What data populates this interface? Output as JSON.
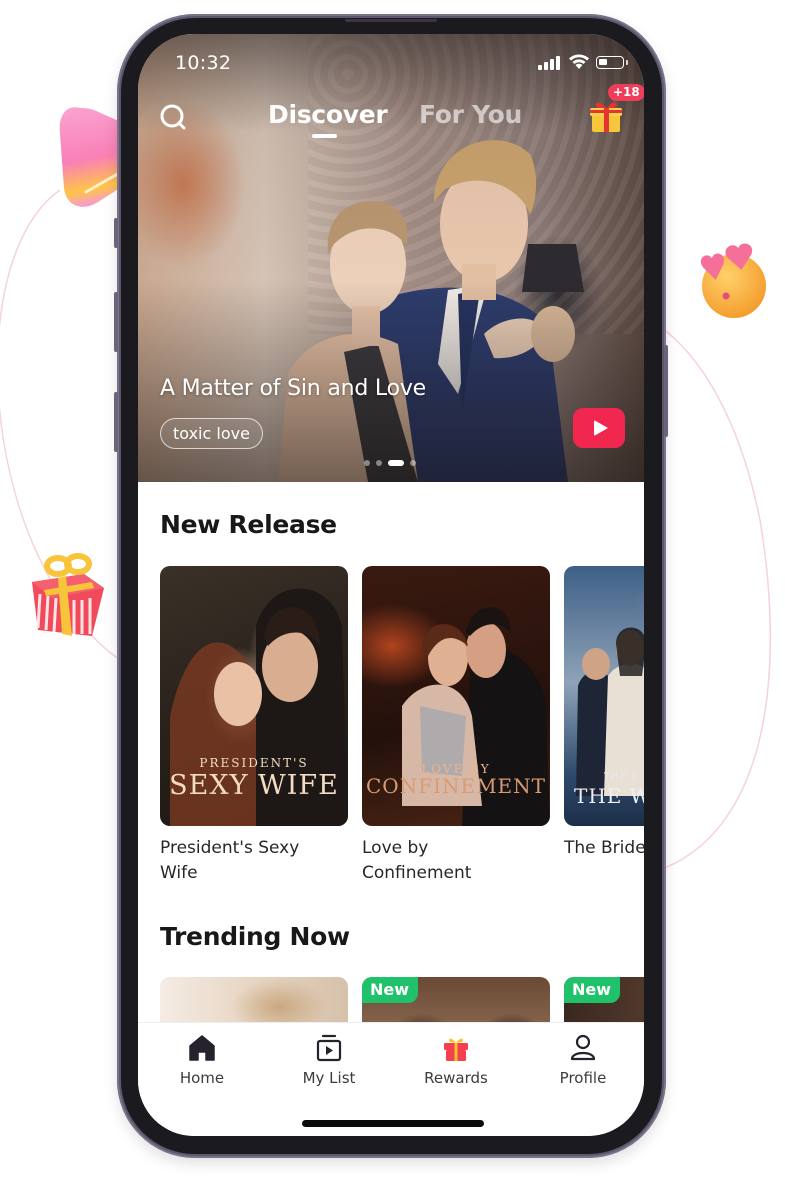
{
  "status_bar": {
    "time": "10:32",
    "battery_level": 0.35
  },
  "top_nav": {
    "search_icon": "search-icon",
    "tabs": [
      {
        "label": "Discover",
        "active": true
      },
      {
        "label": "For You",
        "active": false
      }
    ],
    "gift_icon": "gift-icon",
    "gift_badge": "+18"
  },
  "hero": {
    "title": "A Matter of Sin and Love",
    "tag": "toxic love",
    "play_icon": "play-icon",
    "carousel": {
      "count": 4,
      "active_index": 2
    }
  },
  "new_release": {
    "title": "New Release",
    "items": [
      {
        "title": "President's Sexy Wife",
        "cover_text_small": "PRESIDENT'S",
        "cover_text_large": "SEXY WIFE"
      },
      {
        "title": "Love by Confinement",
        "cover_text_small": "LOVE BY",
        "cover_text_large": "CONFINEMENT"
      },
      {
        "title": "The Bride Wolf King",
        "cover_text_small": "THE B",
        "cover_text_large": "THE WO"
      }
    ]
  },
  "trending": {
    "title": "Trending Now",
    "items": [
      {
        "badge": null
      },
      {
        "badge": "New"
      },
      {
        "badge": "New"
      }
    ]
  },
  "bottom_nav": {
    "items": [
      {
        "label": "Home",
        "icon": "home-icon",
        "active": true
      },
      {
        "label": "My List",
        "icon": "playlist-icon",
        "active": false
      },
      {
        "label": "Rewards",
        "icon": "gift-icon",
        "active": false
      },
      {
        "label": "Profile",
        "icon": "profile-icon",
        "active": false
      }
    ]
  },
  "colors": {
    "accent": "#f2274f",
    "badge_red": "#f03e5a",
    "new_badge_green": "#1fc26b",
    "phone_frame": "#5e566c",
    "text_dark": "#18181b"
  }
}
